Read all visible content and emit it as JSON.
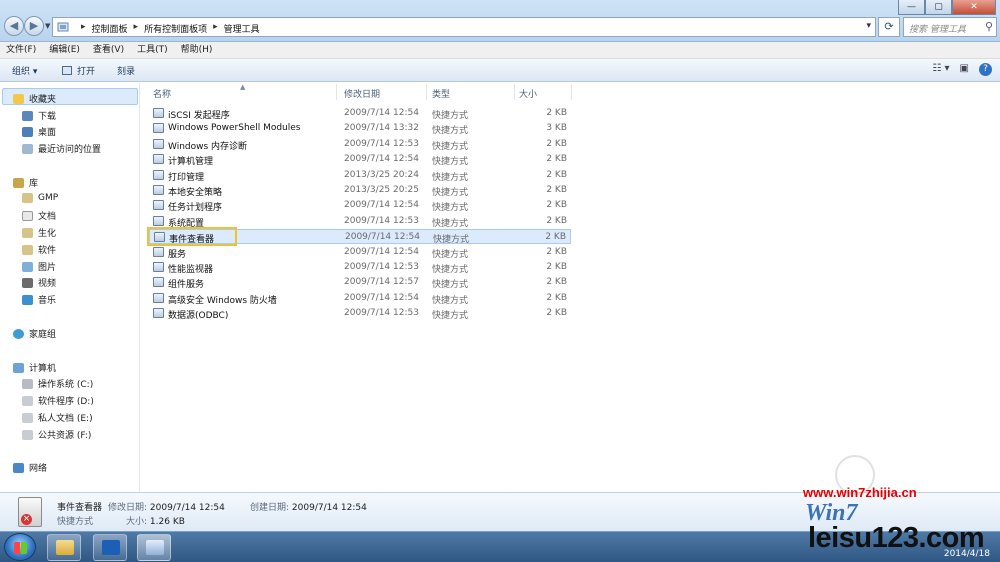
{
  "address_bar": {
    "crumbs": [
      "控制面板",
      "所有控制面板项",
      "管理工具"
    ],
    "search_placeholder": "搜索 管理工具"
  },
  "window_buttons": {
    "minimize": "—",
    "maximize": "▢",
    "close": "✕"
  },
  "menu": [
    "文件(F)",
    "编辑(E)",
    "查看(V)",
    "工具(T)",
    "帮助(H)"
  ],
  "toolbar": {
    "organize": "组织 ▾",
    "open": "打开",
    "burn": "刻录"
  },
  "nav": {
    "favorites": "收藏夹",
    "favorites_items": [
      "下载",
      "桌面",
      "最近访问的位置"
    ],
    "libraries": "库",
    "library_items": [
      "GMP",
      "文档",
      "生化",
      "软件",
      "图片",
      "视频",
      "音乐"
    ],
    "homegroup": "家庭组",
    "computer": "计算机",
    "drives": [
      "操作系统 (C:)",
      "软件程序 (D:)",
      "私人文档 (E:)",
      "公共资源 (F:)"
    ],
    "network": "网络"
  },
  "columns": {
    "name": "名称",
    "date": "修改日期",
    "type": "类型",
    "size": "大小"
  },
  "files": [
    {
      "name": "iSCSI 发起程序",
      "date": "2009/7/14 12:54",
      "type": "快捷方式",
      "size": "2 KB"
    },
    {
      "name": "Windows PowerShell Modules",
      "date": "2009/7/14 13:32",
      "type": "快捷方式",
      "size": "3 KB"
    },
    {
      "name": "Windows 内存诊断",
      "date": "2009/7/14 12:53",
      "type": "快捷方式",
      "size": "2 KB"
    },
    {
      "name": "计算机管理",
      "date": "2009/7/14 12:54",
      "type": "快捷方式",
      "size": "2 KB"
    },
    {
      "name": "打印管理",
      "date": "2013/3/25 20:24",
      "type": "快捷方式",
      "size": "2 KB"
    },
    {
      "name": "本地安全策略",
      "date": "2013/3/25 20:25",
      "type": "快捷方式",
      "size": "2 KB"
    },
    {
      "name": "任务计划程序",
      "date": "2009/7/14 12:54",
      "type": "快捷方式",
      "size": "2 KB"
    },
    {
      "name": "系统配置",
      "date": "2009/7/14 12:53",
      "type": "快捷方式",
      "size": "2 KB"
    },
    {
      "name": "事件查看器",
      "date": "2009/7/14 12:54",
      "type": "快捷方式",
      "size": "2 KB"
    },
    {
      "name": "服务",
      "date": "2009/7/14 12:54",
      "type": "快捷方式",
      "size": "2 KB"
    },
    {
      "name": "性能监视器",
      "date": "2009/7/14 12:53",
      "type": "快捷方式",
      "size": "2 KB"
    },
    {
      "name": "组件服务",
      "date": "2009/7/14 12:57",
      "type": "快捷方式",
      "size": "2 KB"
    },
    {
      "name": "高级安全 Windows 防火墙",
      "date": "2009/7/14 12:54",
      "type": "快捷方式",
      "size": "2 KB"
    },
    {
      "name": "数据源(ODBC)",
      "date": "2009/7/14 12:53",
      "type": "快捷方式",
      "size": "2 KB"
    }
  ],
  "selected_index": 8,
  "details": {
    "name": "事件查看器",
    "modified_label": "修改日期:",
    "modified": "2009/7/14 12:54",
    "created_label": "创建日期:",
    "created": "2009/7/14 12:54",
    "type": "快捷方式",
    "size_label": "大小:",
    "size": "1.26 KB"
  },
  "taskbar": {
    "date": "2014/4/18"
  },
  "watermark": {
    "site": "www.win7zhijia.cn",
    "logo": "Win7",
    "site2": "leisu123.com"
  },
  "colors": {
    "highlight_box": "#f0c233",
    "selection": "#dcebfb"
  }
}
